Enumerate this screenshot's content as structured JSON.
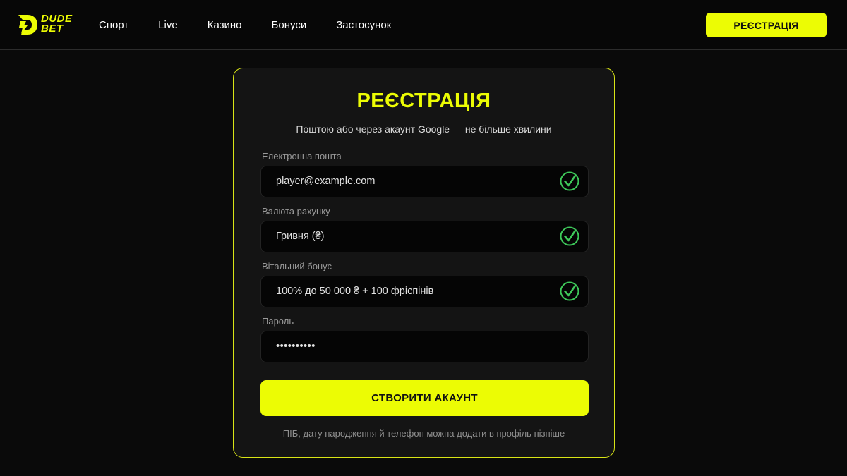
{
  "header": {
    "logo": {
      "line1": "DUDE",
      "line2": "BET",
      "color": "#ecfc04"
    },
    "nav": [
      "Спорт",
      "Live",
      "Казино",
      "Бонуси",
      "Застосунок"
    ],
    "register_label": "РЕЄСТРАЦІЯ"
  },
  "form": {
    "title": "РЕЄСТРАЦІЯ",
    "subtitle": "Поштою або через акаунт Google — не більше хвилини",
    "fields": [
      {
        "label": "Електронна пошта",
        "value": "player@example.com",
        "valid": true
      },
      {
        "label": "Валюта рахунку",
        "value": "Гривня (₴)",
        "valid": true
      },
      {
        "label": "Вітальний бонус",
        "value": "100% до 50 000 ₴ + 100 фріспінів",
        "valid": true
      },
      {
        "label": "Пароль",
        "value": "••••••••••",
        "valid": false
      }
    ],
    "submit_label": "СТВОРИТИ АКАУНТ",
    "footnote": "ПІБ, дату народження й телефон можна додати в профіль пізніше"
  },
  "colors": {
    "accent": "#ecfc04",
    "valid": "#3ec95a",
    "background": "#0a0a0a",
    "card": "#141414"
  },
  "icons": {
    "valid": "check-circle-icon"
  }
}
